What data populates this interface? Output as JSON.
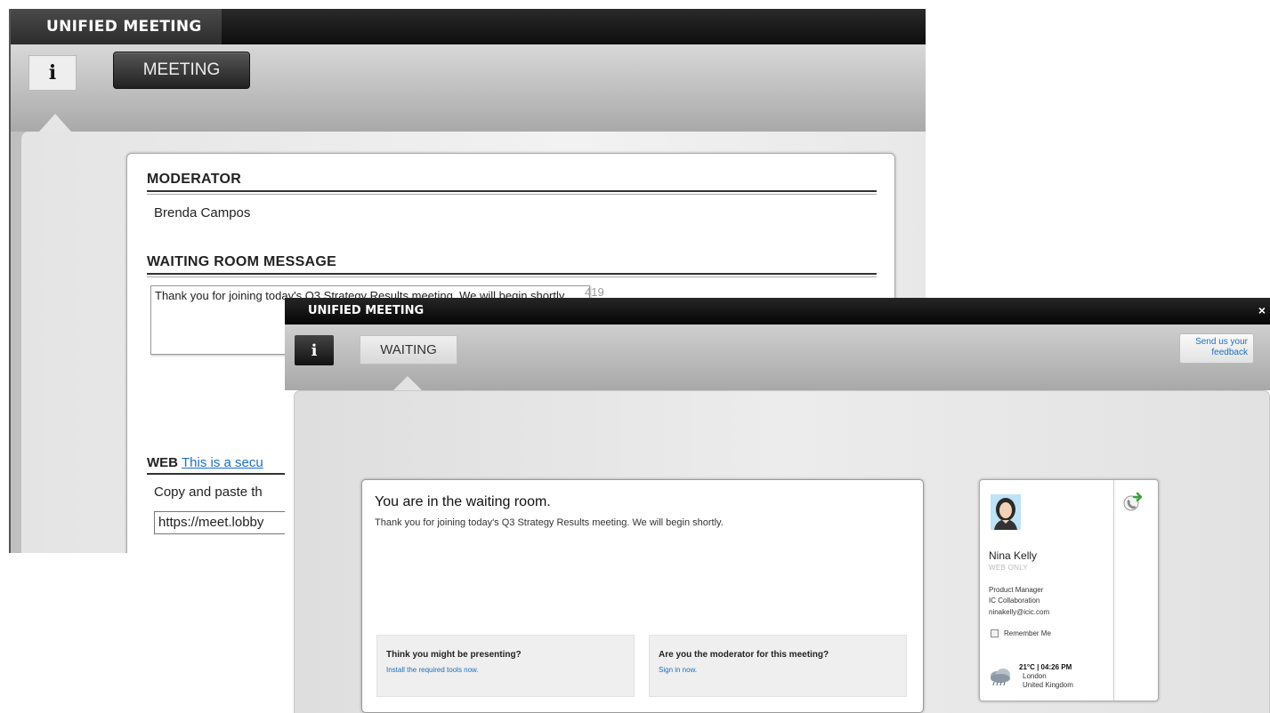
{
  "back_window": {
    "title": "UNIFIED MEETING",
    "info_glyph": "i",
    "tab_meeting": "MEETING",
    "moderator_heading": "MODERATOR",
    "moderator_name": "Brenda Campos",
    "waiting_heading": "WAITING ROOM MESSAGE",
    "waiting_message": "Thank you for joining today's Q3 Strategy Results meeting. We will begin shortly.",
    "char_count_fragment": "419",
    "web_heading": "WEB",
    "web_link_fragment": "This is a secu",
    "copy_fragment": "Copy and paste th",
    "url_fragment": "https://meet.lobby"
  },
  "front_window": {
    "title": "UNIFIED MEETING",
    "close_glyph": "×",
    "info_glyph": "i",
    "tab_waiting": "WAITING",
    "feedback_label": "Send us your feedback",
    "waiting_title": "You are in the waiting room.",
    "waiting_desc": "Thank you for joining today's Q3 Strategy Results meeting. We will begin shortly.",
    "presenting_question": "Think you might be presenting?",
    "presenting_link": "Install the required tools now.",
    "moderator_question": "Are you the moderator for this meeting?",
    "moderator_link": "Sign in now.",
    "profile": {
      "name": "Nina Kelly",
      "status": "WEB ONLY",
      "job_title": "Product Manager",
      "company": "IC Collaboration",
      "email": "ninakelly@icic.com",
      "remember_label": "Remember Me",
      "weather_temp_time": "21°C | 04:26 PM",
      "weather_city": "London",
      "weather_country": "United Kingdom"
    }
  },
  "icons": {
    "avatar": "user-avatar-icon",
    "call": "phone-call-icon",
    "weather": "weather-cloud-icon"
  },
  "colors": {
    "link": "#1c6fc1",
    "titlebar": "#111111",
    "call_arrow": "#3aa33a"
  }
}
